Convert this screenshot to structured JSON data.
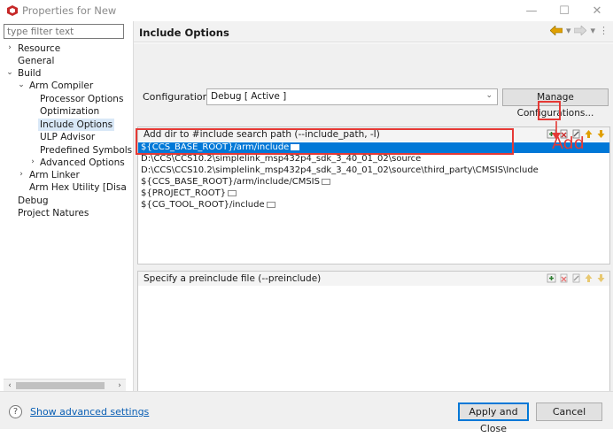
{
  "window": {
    "title": "Properties for New"
  },
  "sidebar": {
    "filter_placeholder": "type filter text",
    "items": [
      {
        "label": "Resource",
        "twisty": "›"
      },
      {
        "label": "General",
        "twisty": ""
      },
      {
        "label": "Build",
        "twisty": "⌄"
      },
      {
        "label": "Arm Compiler",
        "twisty": "⌄"
      },
      {
        "label": "Processor Options",
        "twisty": ""
      },
      {
        "label": "Optimization",
        "twisty": ""
      },
      {
        "label": "Include Options",
        "twisty": ""
      },
      {
        "label": "ULP Advisor",
        "twisty": ""
      },
      {
        "label": "Predefined Symbols",
        "twisty": ""
      },
      {
        "label": "Advanced Options",
        "twisty": "›"
      },
      {
        "label": "Arm Linker",
        "twisty": "›"
      },
      {
        "label": "Arm Hex Utility  [Disable",
        "twisty": ""
      },
      {
        "label": "Debug",
        "twisty": ""
      },
      {
        "label": "Project Natures",
        "twisty": ""
      }
    ],
    "selected_index": 6
  },
  "page": {
    "title": "Include Options"
  },
  "configuration": {
    "label": "Configuration:",
    "value": "Debug  [ Active ]",
    "manage_button": "Manage Configurations..."
  },
  "include_paths": {
    "header": "Add dir to #include search path (--include_path, -I)",
    "rows": [
      "${CCS_BASE_ROOT}/arm/include",
      "D:\\CCS\\CCS10.2\\simplelink_msp432p4_sdk_3_40_01_02\\source",
      "D:\\CCS\\CCS10.2\\simplelink_msp432p4_sdk_3_40_01_02\\source\\third_party\\CMSIS\\Include",
      "${CCS_BASE_ROOT}/arm/include/CMSIS",
      "${PROJECT_ROOT}",
      "${CG_TOOL_ROOT}/include"
    ],
    "selected_index": 0
  },
  "annotation": {
    "add_label": "Add"
  },
  "preinclude": {
    "header": "Specify a preinclude file (--preinclude)"
  },
  "footer": {
    "advanced_link": "Show advanced settings",
    "apply_close": "Apply and Close",
    "cancel": "Cancel"
  },
  "colors": {
    "selection": "#0078d7",
    "annotation": "#e53935",
    "link": "#0a5fb4"
  }
}
